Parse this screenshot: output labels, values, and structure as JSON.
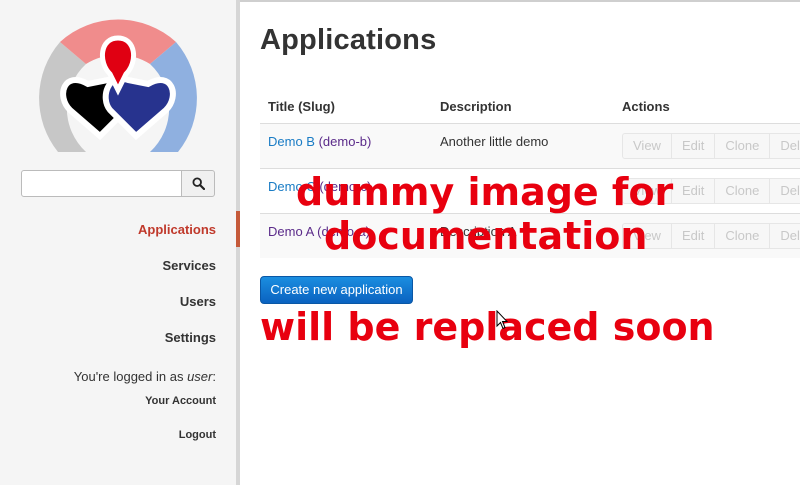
{
  "sidebar": {
    "search": {
      "placeholder": ""
    },
    "nav": [
      "Applications",
      "Services",
      "Users",
      "Settings"
    ],
    "login_prefix": "You're logged in as ",
    "login_user": "user",
    "login_suffix": ":",
    "account_link": "Your Account",
    "logout_link": "Logout"
  },
  "main": {
    "title": "Applications",
    "table": {
      "headers": [
        "Title (Slug)",
        "Description",
        "Actions"
      ],
      "rows": [
        {
          "title": "Demo B",
          "slug": "(demo-b)",
          "description": "Another little demo"
        },
        {
          "title": "Demo C",
          "slug": "(demo-c)",
          "description": ""
        },
        {
          "title": "Demo A",
          "slug": "(demo-a)",
          "description": "Description A"
        }
      ],
      "actions": [
        "View",
        "Edit",
        "Clone",
        "Delete"
      ]
    },
    "create_button": "Create new application"
  },
  "overlay": {
    "line1": "dummy image for",
    "line2": "documentation",
    "line3": "will be replaced soon"
  },
  "colors": {
    "accent": "#c0392b",
    "link": "#1a7cc5",
    "slug": "#5b2b8a",
    "overlay": "#e8000f",
    "primary_button": "#0a62c0"
  },
  "icons": {
    "search": "magnifier-icon",
    "logo": "app-logo"
  }
}
